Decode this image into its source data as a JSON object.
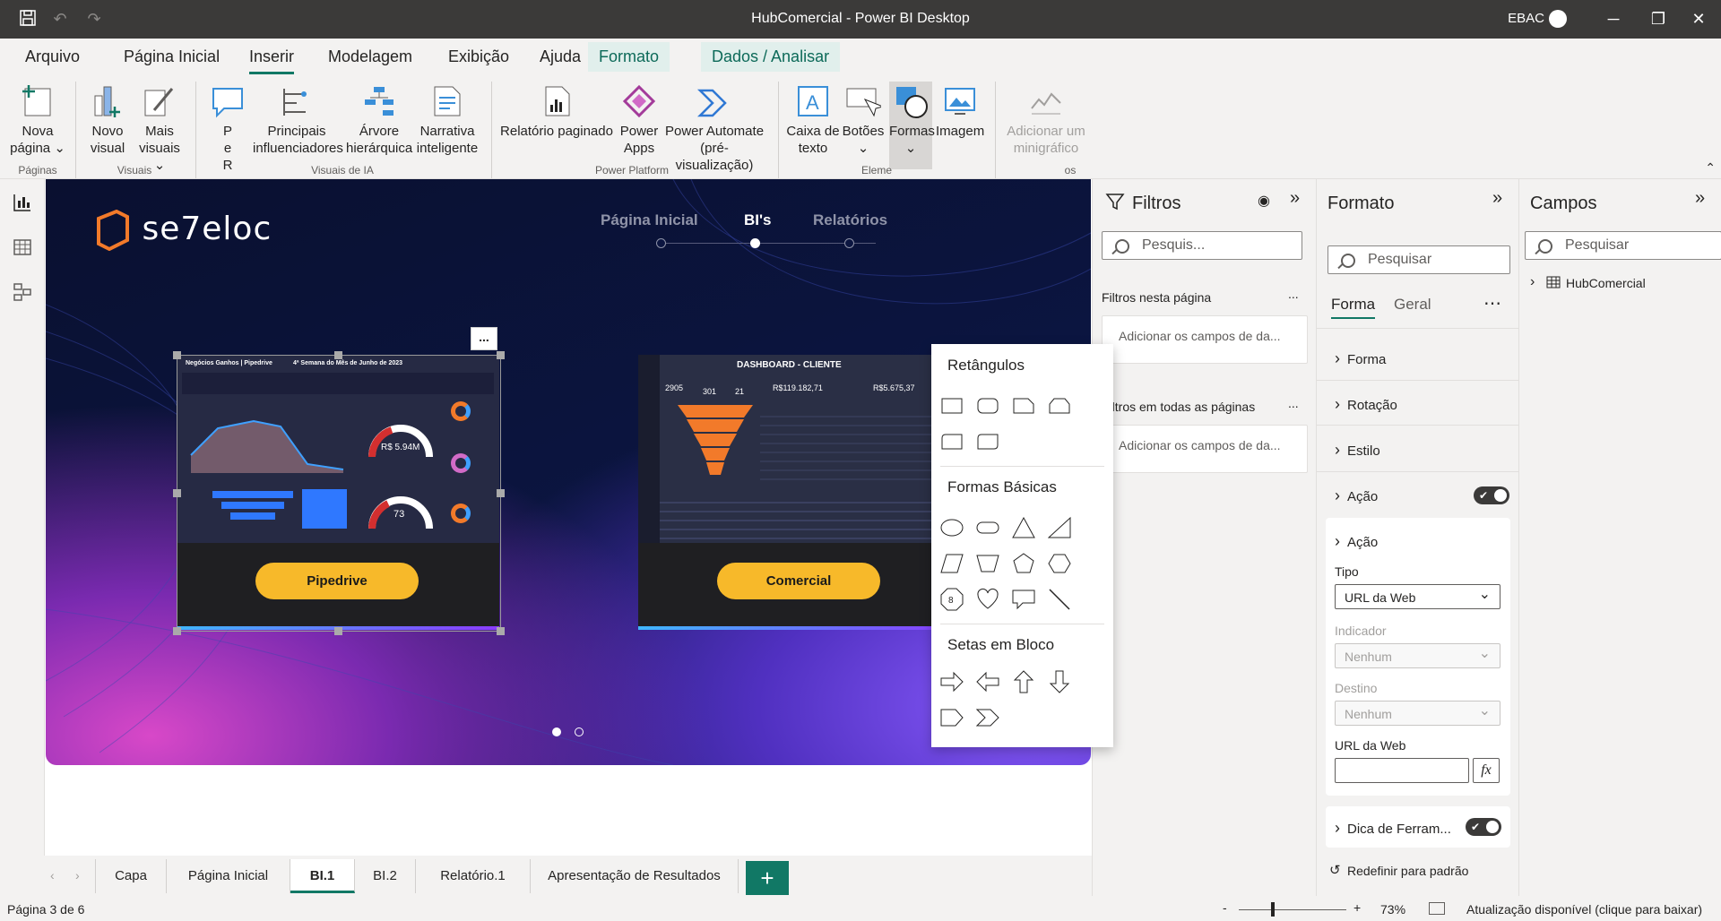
{
  "titlebar": {
    "title": "HubComercial - Power BI Desktop",
    "user": "EBAC",
    "minimize": "─",
    "restore": "❐",
    "close": "✕"
  },
  "menu": {
    "items": [
      "Arquivo",
      "Página Inicial",
      "Inserir",
      "Modelagem",
      "Exibição",
      "Ajuda"
    ],
    "context": [
      "Formato",
      "Dados / Analisar"
    ]
  },
  "ribbon": {
    "buttons": {
      "nova_pagina": "Nova página ⌄",
      "novo_visual": "Novo visual",
      "mais_visuais": "Mais visuais ⌄",
      "pe_r": "P e R",
      "influenciadores": "Principais influenciadores",
      "arvore": "Árvore hierárquica",
      "narrativa": "Narrativa inteligente",
      "relatorio_paginado": "Relatório paginado",
      "power_apps": "Power Apps",
      "power_automate": "Power Automate (pré-visualização)",
      "caixa_texto": "Caixa de texto",
      "botoes": "Botões ⌄",
      "formas": "Formas ⌄",
      "imagem": "Imagem",
      "minigrafico": "Adicionar um minigráfico"
    },
    "groups": {
      "paginas": "Páginas",
      "visuais": "Visuais",
      "ia": "Visuais de IA",
      "power_platform": "Power Platform",
      "elementos": "Eleme",
      "minigraficos": "os"
    }
  },
  "report": {
    "logo": "se7eloc",
    "nav": [
      "Página Inicial",
      "BI's",
      "Relatórios"
    ],
    "cards": [
      {
        "button": "Pipedrive",
        "thumb_title": "Negócios Ganhos | Pipedrive",
        "thumb_sub": "4ª Semana do Mês de Junho de 2023",
        "gauge": "R$ 5.94M",
        "gauge2": "73"
      },
      {
        "button": "Comercial",
        "thumb_title": "DASHBOARD - CLIENTE",
        "kpi1": "2905",
        "kpi2": "301",
        "kpi3": "21",
        "kpi4": "R$119.182,71",
        "kpi5": "R$5.675,37"
      }
    ],
    "more": "..."
  },
  "shapes_dropdown": {
    "sections": [
      "Retângulos",
      "Formas Básicas",
      "Setas em Bloco"
    ]
  },
  "filters": {
    "title": "Filtros",
    "search": "Pesquis...",
    "this_page": "Filtros nesta página",
    "all_pages": "Filtros em todas as páginas",
    "add_fields": "Adicionar os campos de da...",
    "more": "..."
  },
  "format": {
    "title": "Formato",
    "search": "Pesquisar",
    "tabs": [
      "Forma",
      "Geral"
    ],
    "more": "⋯",
    "sections": [
      "Forma",
      "Rotação",
      "Estilo",
      "Ação"
    ],
    "acao_inner": "Ação",
    "tipo_label": "Tipo",
    "tipo_value": "URL da Web",
    "indicador_label": "Indicador",
    "indicador_value": "Nenhum",
    "destino_label": "Destino",
    "destino_value": "Nenhum",
    "url_label": "URL da Web",
    "fx": "fx",
    "dica": "Dica de Ferram...",
    "reset": "Redefinir para padrão",
    "toggle_state": "on"
  },
  "fields": {
    "title": "Campos",
    "search": "Pesquisar",
    "table": "HubComercial"
  },
  "tabs": {
    "items": [
      "Capa",
      "Página Inicial",
      "BI.1",
      "BI.2",
      "Relatório.1",
      "Apresentação de Resultados"
    ],
    "add": "+",
    "active": "BI.1"
  },
  "status": {
    "page": "Página 3 de 6",
    "zoom": "73%",
    "update": "Atualização disponível (clique para baixar)",
    "minus": "-",
    "plus": "+"
  },
  "colors": {
    "accent": "#117865",
    "yellow_button": "#f7b92a",
    "titlebar": "#3b3a39"
  }
}
